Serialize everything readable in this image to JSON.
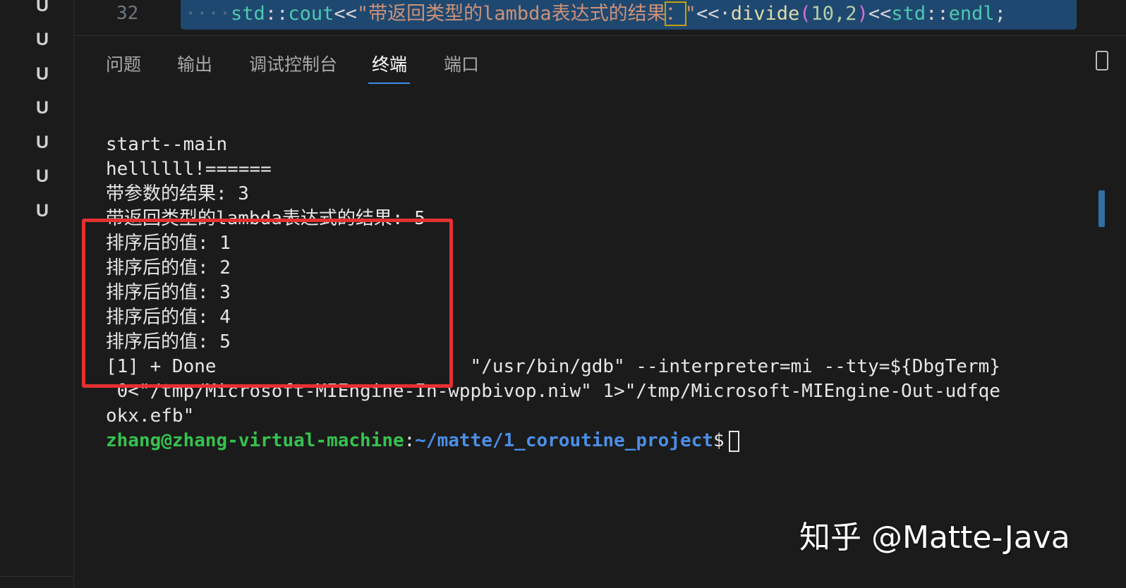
{
  "gutter": {
    "status_letters": [
      "U",
      "U",
      "U",
      "U",
      "U",
      "U",
      "U"
    ]
  },
  "editor": {
    "line_number": "32",
    "code": {
      "indent": "····",
      "ns1": "std",
      "scope1": "::",
      "cout": "cout",
      "op1": "<<",
      "string_a": "\"带返回类型的lambda表达式的结果",
      "string_colon": "：",
      "string_b": "\"",
      "op2": "<<·",
      "fn": "divide",
      "paren_open": "(",
      "args": "10,2",
      "paren_close": ")",
      "op3": "<<",
      "ns2": "std",
      "scope2": "::",
      "endl": "endl",
      "semi": ";"
    }
  },
  "panel": {
    "tabs": [
      {
        "label": "问题"
      },
      {
        "label": "输出"
      },
      {
        "label": "调试控制台"
      },
      {
        "label": "终端"
      },
      {
        "label": "端口"
      }
    ],
    "active_tab": "终端"
  },
  "terminal": {
    "lines": [
      "start--main",
      "hellllll!======",
      "带参数的结果: 3",
      "带返回类型的lambda表达式的结果: 5",
      "排序后的值: 1",
      "排序后的值: 2",
      "排序后的值: 3",
      "排序后的值: 4",
      "排序后的值: 5",
      "[1] + Done                       \"/usr/bin/gdb\" --interpreter=mi --tty=${DbgTerm}",
      " 0<\"/tmp/Microsoft-MIEngine-In-wppbivop.niw\" 1>\"/tmp/Microsoft-MIEngine-Out-udfqe",
      "okx.efb\""
    ],
    "prompt": {
      "user_host": "zhang@zhang-virtual-machine",
      "separator": ":",
      "path": "~/matte/1_coroutine_project",
      "symbol": "$"
    }
  },
  "annotation": {
    "color": "#e53030"
  },
  "colors": {
    "prompt_user": "#36c24f",
    "prompt_path": "#4a8fe6",
    "tab_underline": "#3b8eea"
  },
  "watermark": "知乎 @Matte-Java"
}
